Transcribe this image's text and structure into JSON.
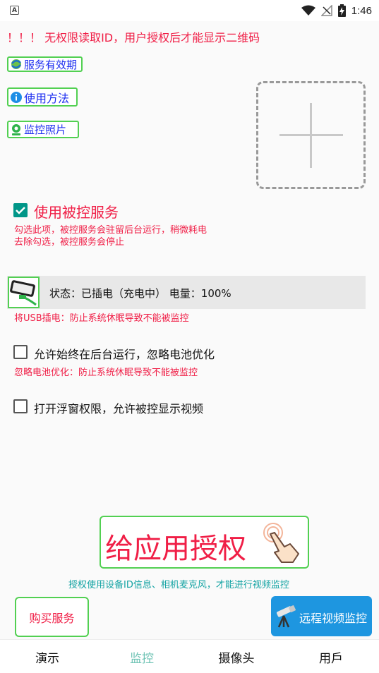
{
  "status_bar": {
    "left_icon_text": "A",
    "time": "1:46",
    "icons": [
      "wifi-icon",
      "signal-off-icon",
      "battery-charging-icon"
    ]
  },
  "warning": "！！！ 无权限读取ID，用户授权后才能显示二维码",
  "buttons": {
    "service_validity": "服务有效期",
    "usage": "使用方法",
    "monitor_photos": "监控照片"
  },
  "add_box_icon": "plus-icon",
  "controlled_service": {
    "label": "使用被控服务",
    "checked": true,
    "note_line1": "勾选此项，被控服务会驻留后台运行，稍微耗电",
    "note_line2": "去除勾选，被控服务会停止"
  },
  "power_status": {
    "text": "状态：已插电（充电中） 电量：100%",
    "note": "将USB插电：防止系统休眠导致不能被监控"
  },
  "background_run": {
    "label": "允许始终在后台运行，忽略电池优化",
    "checked": false,
    "note": "忽略电池优化：防止系统休眠导致不能被监控"
  },
  "floating_window": {
    "label": "打开浮窗权限，允许被控显示视频",
    "checked": false
  },
  "grant": {
    "label": "给应用授权",
    "note": "授权使用设备ID信息、相机麦克风，才能进行视频监控"
  },
  "buy_service": "购买服务",
  "remote_monitor": "远程视频监控",
  "nav": {
    "items": [
      "演示",
      "监控",
      "摄像头",
      "用戶"
    ],
    "active": "监控"
  },
  "colors": {
    "red": "#f01e46",
    "green_border": "#52d052",
    "teal": "#009688",
    "blue": "#1e96e0",
    "link_blue": "#1e2ff0"
  }
}
